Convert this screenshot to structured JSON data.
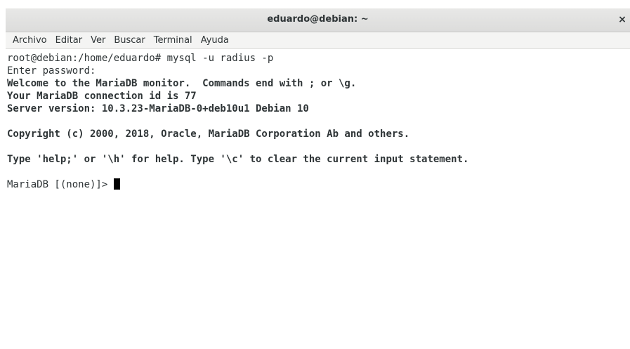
{
  "window": {
    "title": "eduardo@debian: ~",
    "close_glyph": "×"
  },
  "menu": {
    "items": [
      "Archivo",
      "Editar",
      "Ver",
      "Buscar",
      "Terminal",
      "Ayuda"
    ]
  },
  "terminal": {
    "lines": [
      "root@debian:/home/eduardo# mysql -u radius -p",
      "Enter password:",
      "Welcome to the MariaDB monitor.  Commands end with ; or \\g.",
      "Your MariaDB connection id is 77",
      "Server version: 10.3.23-MariaDB-0+deb10u1 Debian 10",
      "",
      "Copyright (c) 2000, 2018, Oracle, MariaDB Corporation Ab and others.",
      "",
      "Type 'help;' or '\\h' for help. Type '\\c' to clear the current input statement.",
      ""
    ],
    "prompt": "MariaDB [(none)]> "
  }
}
